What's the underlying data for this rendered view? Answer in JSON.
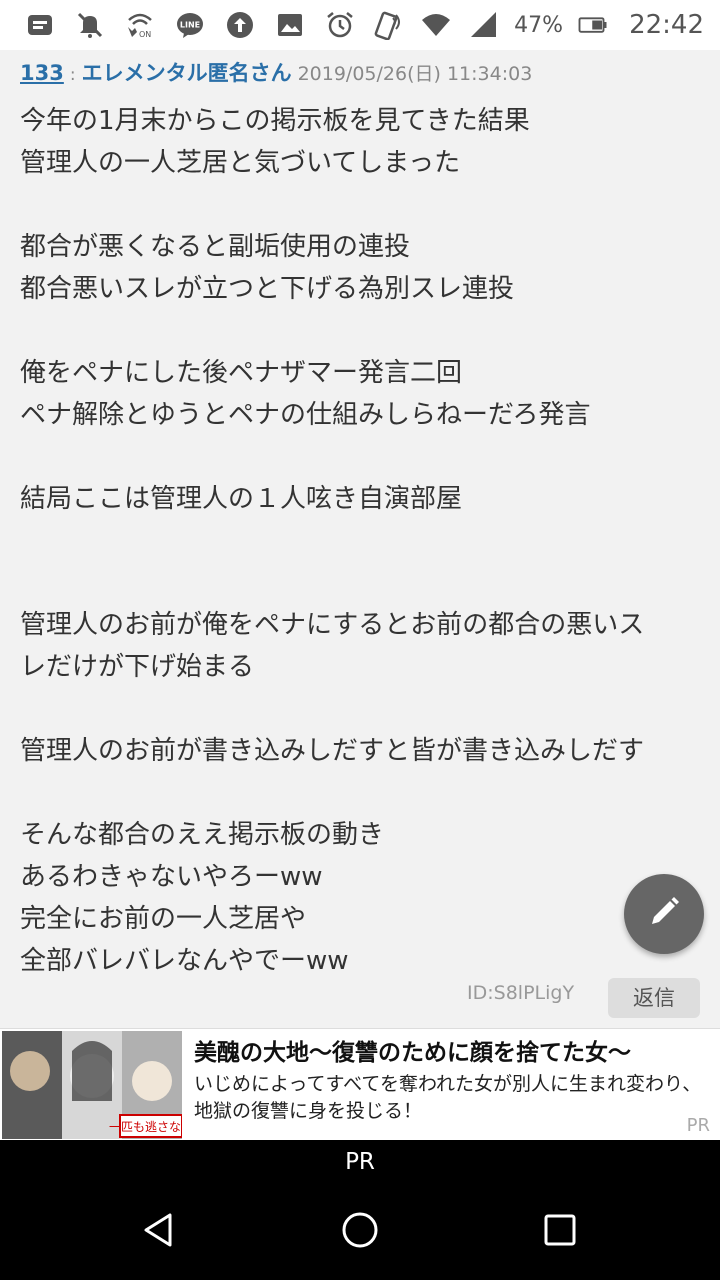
{
  "status_bar": {
    "battery_percent": "47%",
    "time": "22:42",
    "left_icons": [
      "notification-icon",
      "mute-icon",
      "wifi-calling-icon",
      "line-icon",
      "upload-icon",
      "image-icon"
    ],
    "right_icons": [
      "alarm-icon",
      "nfc-icon",
      "wifi-icon",
      "signal-icon",
      "battery-icon"
    ]
  },
  "post": {
    "number": "133",
    "separator": ":",
    "author": "エレメンタル匿名さん",
    "date": "2019/05/26(日) 11:34:03",
    "lines": [
      "今年の1月末からこの掲示板を見てきた結果",
      "管理人の一人芝居と気づいてしまった",
      "",
      "都合が悪くなると副垢使用の連投",
      "都合悪いスレが立つと下げる為別スレ連投",
      "",
      "俺をペナにした後ペナザマー発言二回",
      "ペナ解除とゆうとペナの仕組みしらねーだろ発言",
      "",
      "結局ここは管理人の１人呟き自演部屋",
      "",
      "",
      "管理人のお前が俺をペナにするとお前の都合の悪いス",
      "レだけが下げ始まる",
      "",
      "管理人のお前が書き込みしだすと皆が書き込みしだす",
      "",
      "そんな都合のええ掲示板の動き",
      "あるわきゃないやろーww",
      "完全にお前の一人芝居や",
      "全部バレバレなんやでーww"
    ],
    "id_text": "ID:S8lPLigY",
    "reply_label": "返信"
  },
  "ad": {
    "title": "美醜の大地～復讐のために顔を捨てた女～",
    "description": "いじめによってすべてを奪われた女が別人に生まれ変わり、地獄の復讐に身を投じる！",
    "pr_label": "PR",
    "thumb_caption": "一匹も逃さない"
  },
  "pr_bar": {
    "label": "PR"
  },
  "colors": {
    "accent": "#2a6fa8",
    "fab": "#666666",
    "background": "#f2f2f2"
  }
}
